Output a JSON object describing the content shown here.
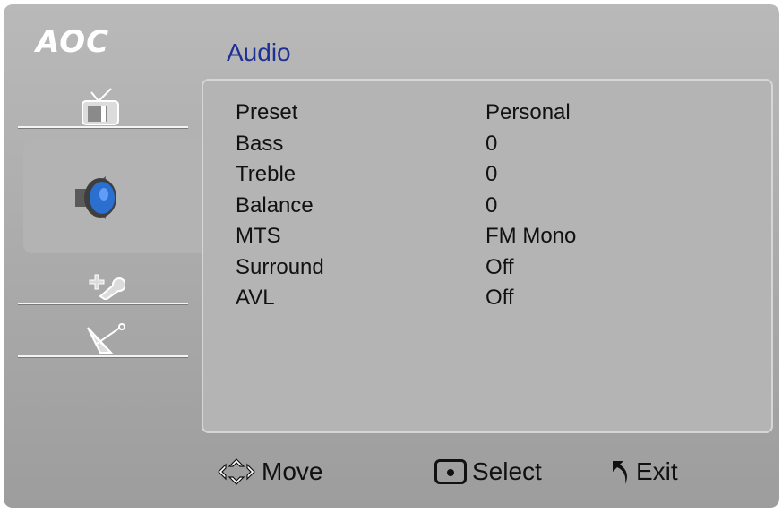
{
  "brand": {
    "logo": "AOC"
  },
  "menu": {
    "title": "Audio"
  },
  "sidebar": {
    "tabs": [
      {
        "name": "picture",
        "icon": "tv-icon",
        "selected": false
      },
      {
        "name": "audio",
        "icon": "speaker-icon",
        "selected": true
      },
      {
        "name": "setup",
        "icon": "tools-icon",
        "selected": false
      },
      {
        "name": "channel",
        "icon": "satellite-dish-icon",
        "selected": false
      }
    ]
  },
  "settings": [
    {
      "label": "Preset",
      "value": "Personal"
    },
    {
      "label": "Bass",
      "value": "0"
    },
    {
      "label": "Treble",
      "value": "0"
    },
    {
      "label": "Balance",
      "value": "0"
    },
    {
      "label": "MTS",
      "value": "FM Mono"
    },
    {
      "label": "Surround",
      "value": "Off"
    },
    {
      "label": "AVL",
      "value": "Off"
    }
  ],
  "footer": {
    "move_label": "Move",
    "select_label": "Select",
    "exit_label": "Exit"
  },
  "colors": {
    "title": "#1e2f96",
    "speaker_accent": "#2b6fd1"
  }
}
